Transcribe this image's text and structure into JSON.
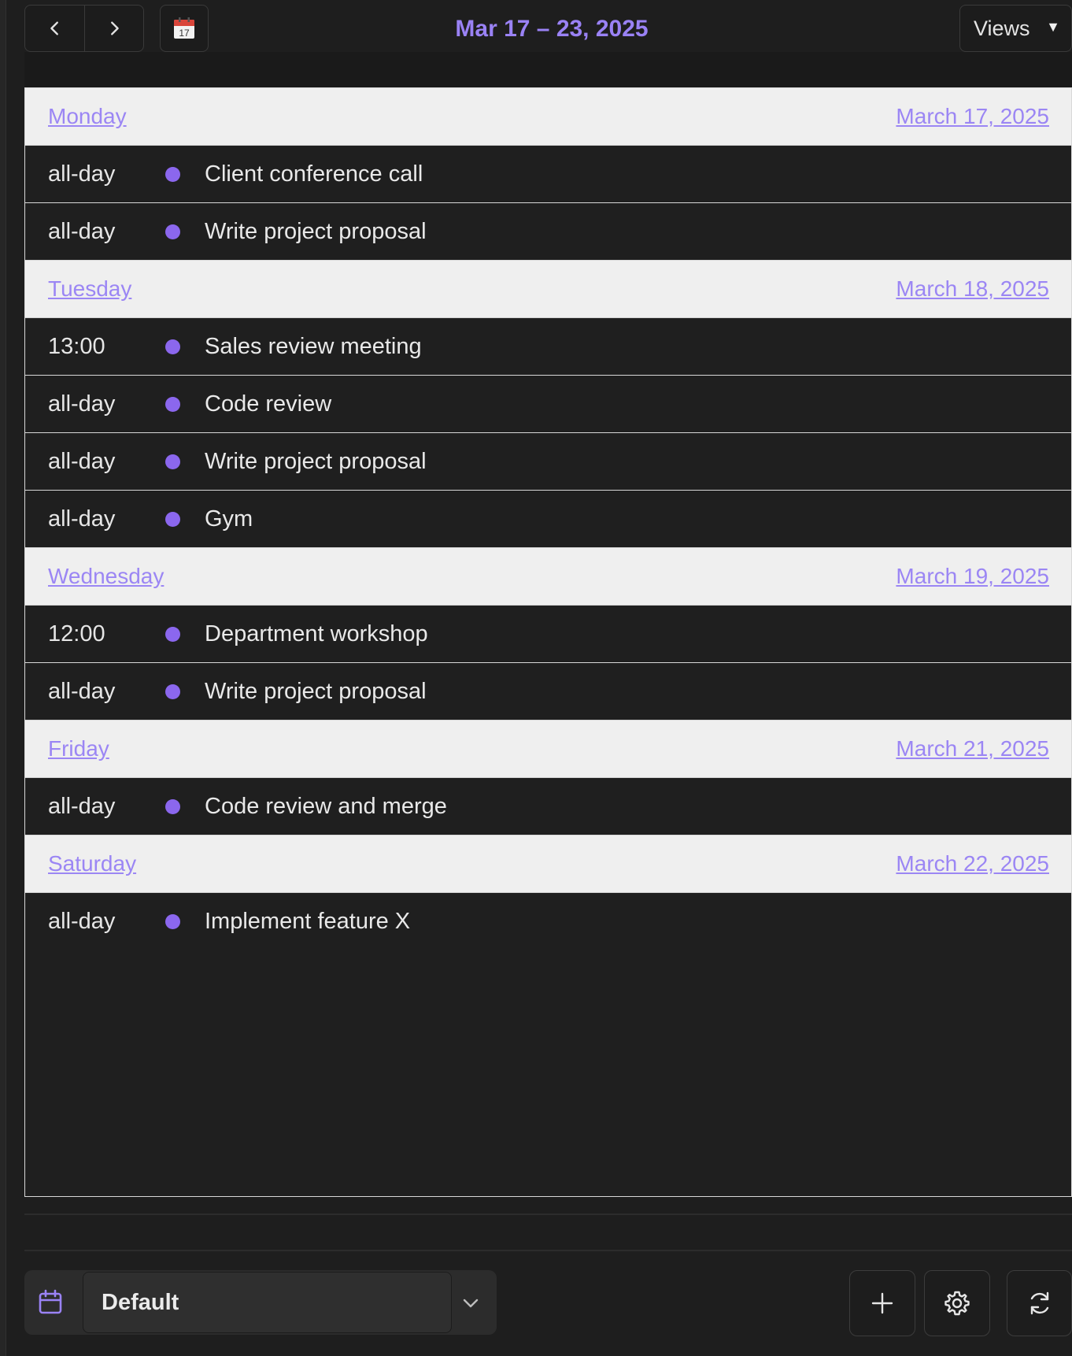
{
  "toolbar": {
    "prev_icon": "chevron-left-icon",
    "next_icon": "chevron-right-icon",
    "today_icon": "calendar-17-icon",
    "today_icon_number": "17",
    "title": "Mar 17 – 23, 2025",
    "views_label": "Views",
    "views_caret": "▼"
  },
  "days": [
    {
      "name": "Monday",
      "date": "March 17, 2025",
      "events": [
        {
          "time": "all-day",
          "title": "Client conference call"
        },
        {
          "time": "all-day",
          "title": "Write project proposal"
        }
      ]
    },
    {
      "name": "Tuesday",
      "date": "March 18, 2025",
      "events": [
        {
          "time": "13:00",
          "title": "Sales review meeting"
        },
        {
          "time": "all-day",
          "title": "Code review"
        },
        {
          "time": "all-day",
          "title": "Write project proposal"
        },
        {
          "time": "all-day",
          "title": "Gym"
        }
      ]
    },
    {
      "name": "Wednesday",
      "date": "March 19, 2025",
      "events": [
        {
          "time": "12:00",
          "title": "Department workshop"
        },
        {
          "time": "all-day",
          "title": "Write project proposal"
        }
      ]
    },
    {
      "name": "Friday",
      "date": "March 21, 2025",
      "events": [
        {
          "time": "all-day",
          "title": "Code review and merge"
        }
      ]
    },
    {
      "name": "Saturday",
      "date": "March 22, 2025",
      "events": [
        {
          "time": "all-day",
          "title": "Implement feature X"
        }
      ]
    }
  ],
  "footer": {
    "calendar_icon": "calendar-icon",
    "calendar_select_value": "Default",
    "dropdown_icon": "chevron-down-icon",
    "add_icon": "plus-icon",
    "settings_icon": "gear-icon",
    "refresh_icon": "refresh-icon"
  },
  "colors": {
    "accent": "#9a82f5",
    "event_dot": "#8b67ee",
    "background": "#1e1e1e",
    "day_header_bg": "#efefef"
  }
}
